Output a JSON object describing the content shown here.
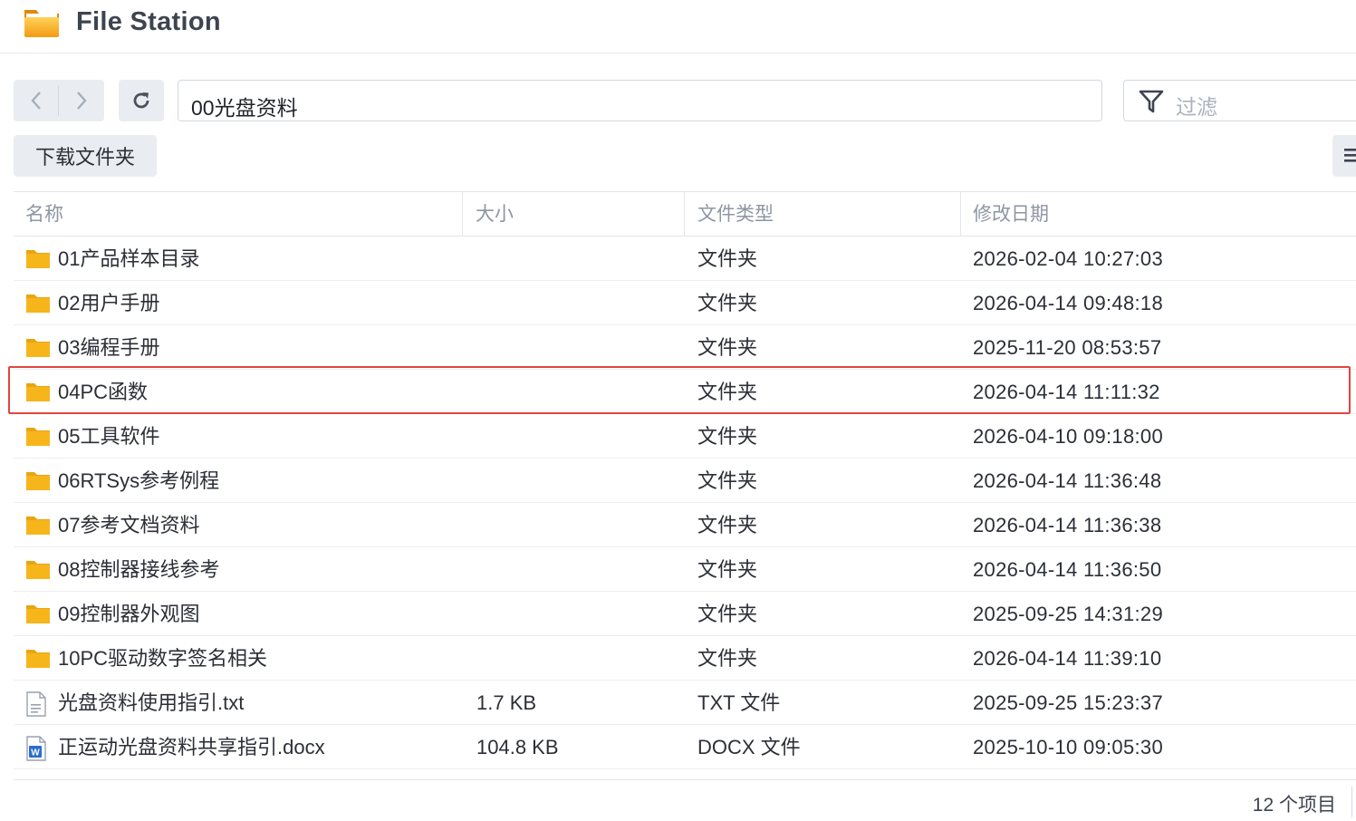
{
  "app": {
    "title": "File Station"
  },
  "toolbar": {
    "path_value": "00光盘资料",
    "filter_placeholder": "过滤",
    "download_label": "下载文件夹"
  },
  "table": {
    "columns": [
      "名称",
      "大小",
      "文件类型",
      "修改日期"
    ],
    "rows": [
      {
        "icon": "folder-icon",
        "name": "01产品样本目录",
        "size": "",
        "type": "文件夹",
        "modified": "2026-02-04 10:27:03"
      },
      {
        "icon": "folder-icon",
        "name": "02用户手册",
        "size": "",
        "type": "文件夹",
        "modified": "2026-04-14 09:48:18"
      },
      {
        "icon": "folder-icon",
        "name": "03编程手册",
        "size": "",
        "type": "文件夹",
        "modified": "2025-11-20 08:53:57"
      },
      {
        "icon": "folder-icon",
        "name": "04PC函数",
        "size": "",
        "type": "文件夹",
        "modified": "2026-04-14 11:11:32",
        "highlighted": true
      },
      {
        "icon": "folder-icon",
        "name": "05工具软件",
        "size": "",
        "type": "文件夹",
        "modified": "2026-04-10 09:18:00"
      },
      {
        "icon": "folder-icon",
        "name": "06RTSys参考例程",
        "size": "",
        "type": "文件夹",
        "modified": "2026-04-14 11:36:48"
      },
      {
        "icon": "folder-icon",
        "name": "07参考文档资料",
        "size": "",
        "type": "文件夹",
        "modified": "2026-04-14 11:36:38"
      },
      {
        "icon": "folder-icon",
        "name": "08控制器接线参考",
        "size": "",
        "type": "文件夹",
        "modified": "2026-04-14 11:36:50"
      },
      {
        "icon": "folder-icon",
        "name": "09控制器外观图",
        "size": "",
        "type": "文件夹",
        "modified": "2025-09-25 14:31:29"
      },
      {
        "icon": "folder-icon",
        "name": "10PC驱动数字签名相关",
        "size": "",
        "type": "文件夹",
        "modified": "2026-04-14 11:39:10"
      },
      {
        "icon": "txt-file-icon",
        "name": "光盘资料使用指引.txt",
        "size": "1.7 KB",
        "type": "TXT 文件",
        "modified": "2025-09-25 15:23:37"
      },
      {
        "icon": "docx-file-icon",
        "name": "正运动光盘资料共享指引.docx",
        "size": "104.8 KB",
        "type": "DOCX 文件",
        "modified": "2025-10-10 09:05:30"
      }
    ]
  },
  "footer": {
    "item_count": "12 个项目"
  },
  "colors": {
    "folder": "#f7b51c",
    "highlight_border": "#e0463f",
    "docx_blue": "#2b6cd1"
  }
}
